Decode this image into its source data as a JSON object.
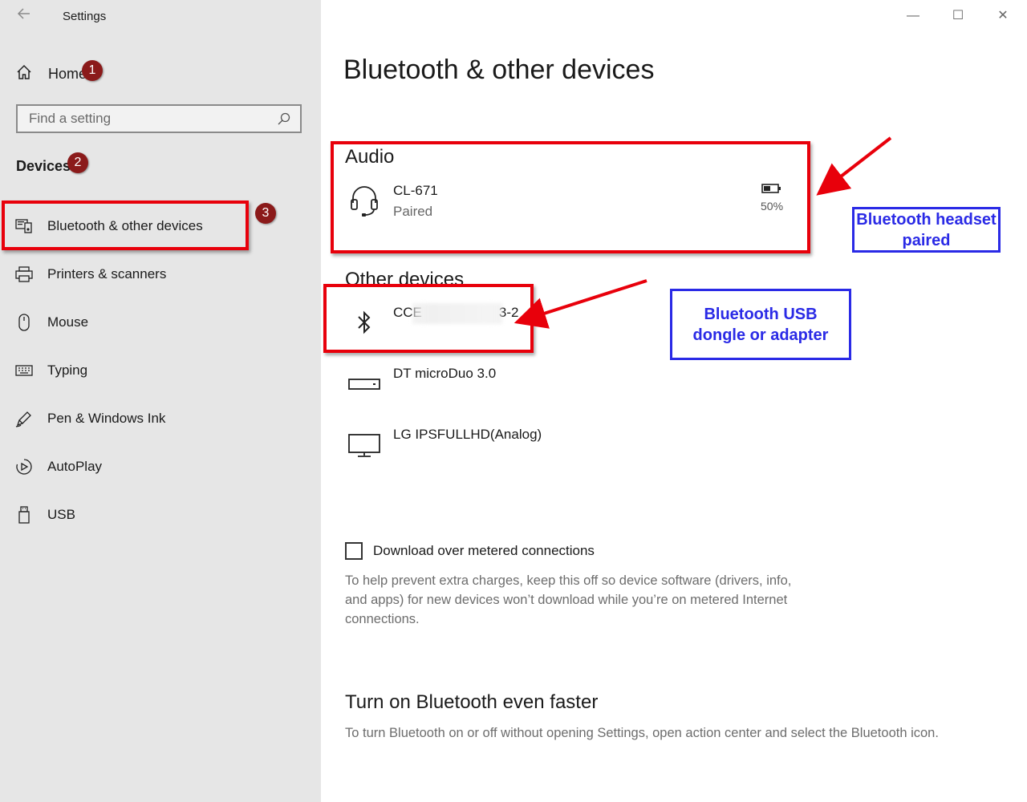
{
  "window": {
    "title": "Settings",
    "controls": {
      "minimize": "—",
      "maximize": "☐",
      "close": "✕"
    }
  },
  "sidebar": {
    "home_label": "Home",
    "search": {
      "placeholder": "Find a setting"
    },
    "section_label": "Devices",
    "items": [
      {
        "label": "Bluetooth & other devices",
        "icon": "bluetooth-devices-icon",
        "selected": true
      },
      {
        "label": "Printers & scanners",
        "icon": "printer-icon"
      },
      {
        "label": "Mouse",
        "icon": "mouse-icon"
      },
      {
        "label": "Typing",
        "icon": "keyboard-icon"
      },
      {
        "label": "Pen & Windows Ink",
        "icon": "pen-icon"
      },
      {
        "label": "AutoPlay",
        "icon": "autoplay-icon"
      },
      {
        "label": "USB",
        "icon": "usb-icon"
      }
    ]
  },
  "main": {
    "page_title": "Bluetooth & other devices",
    "audio": {
      "title": "Audio",
      "device": {
        "name": "CL-671",
        "status": "Paired",
        "battery": "50%",
        "battery_level": 0.5
      }
    },
    "other": {
      "title": "Other devices",
      "devices": [
        {
          "name": "CCE",
          "name_suffix": "3-2",
          "icon": "bluetooth-icon"
        },
        {
          "name": "DT microDuo 3.0",
          "icon": "usb-drive-icon"
        },
        {
          "name": "LG IPSFULLHD(Analog)",
          "icon": "monitor-icon"
        }
      ]
    },
    "metered": {
      "label": "Download over metered connections",
      "checked": false,
      "help": "To help prevent extra charges, keep this off so device software (drivers, info, and apps) for new devices won’t download while you’re on metered Internet connections."
    },
    "faster": {
      "title": "Turn on Bluetooth even faster",
      "text": "To turn Bluetooth on or off without opening Settings, open action center and select the Bluetooth icon."
    }
  },
  "annotations": {
    "badges": [
      "1",
      "2",
      "3"
    ],
    "headset_note": "Bluetooth headset paired",
    "dongle_note": "Bluetooth USB dongle or adapter",
    "red": "#e8000b",
    "blue": "#2a2ae6",
    "badge_color": "#8b1a1a"
  }
}
